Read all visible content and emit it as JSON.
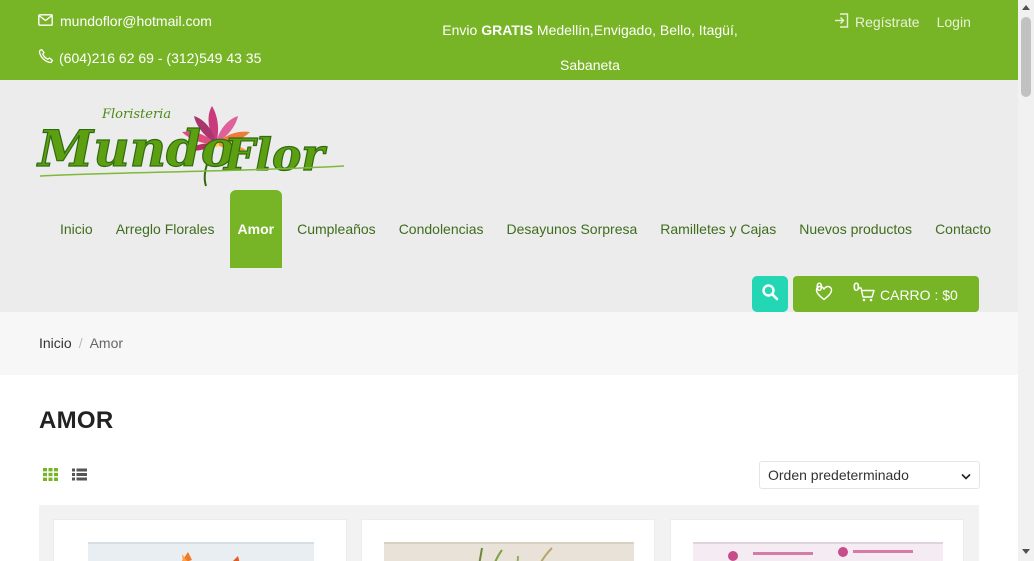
{
  "topbar": {
    "email": "mundoflor@hotmail.com",
    "phone": "(604)216 62 69 - (312)549 43 35",
    "shipping_prefix": "Envio ",
    "shipping_bold": "GRATIS",
    "shipping_line1_rest": " Medellín,Envigado, Bello, Itagüí,",
    "shipping_line2": "Sabaneta",
    "register_label": "Regístrate",
    "login_label": "Login"
  },
  "logo": {
    "top_text": "Floristeria",
    "main_text_1": "Mundo",
    "main_text_2": "Flor"
  },
  "nav": {
    "items": [
      {
        "label": "Inicio"
      },
      {
        "label": "Arreglo Florales"
      },
      {
        "label": "Amor"
      },
      {
        "label": "Cumpleaños"
      },
      {
        "label": "Condolencias"
      },
      {
        "label": "Desayunos Sorpresa"
      },
      {
        "label": "Ramilletes y Cajas"
      },
      {
        "label": "Nuevos productos"
      },
      {
        "label": "Contacto"
      }
    ],
    "active_index": 2
  },
  "cart": {
    "wishlist_count": "0",
    "cart_count": "0",
    "label": "CARRO : $0"
  },
  "breadcrumb": {
    "home": "Inicio",
    "separator": "/",
    "current": "Amor"
  },
  "page": {
    "title": "AMOR"
  },
  "sort": {
    "selected": "Orden predeterminado"
  },
  "colors": {
    "brand_green": "#78b526",
    "nav_text": "#3f6d1d",
    "search_accent": "#23d6b4"
  }
}
